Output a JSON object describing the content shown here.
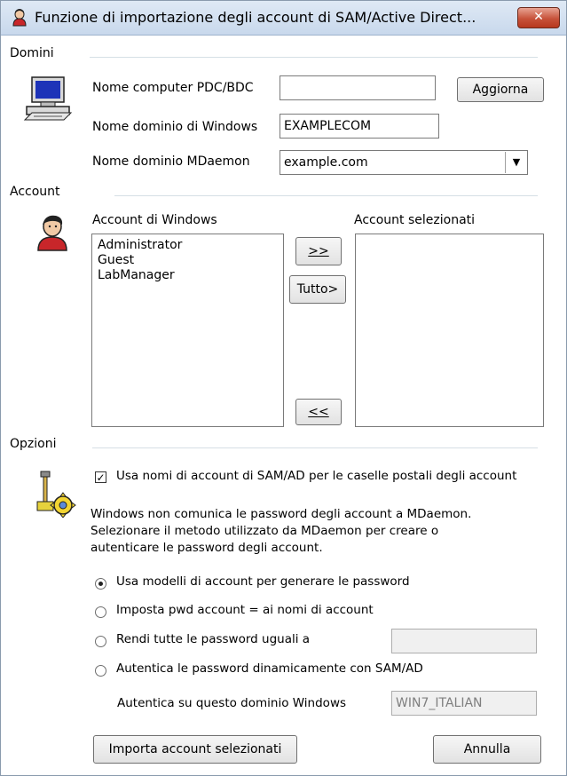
{
  "window": {
    "title": "Funzione di importazione degli account di SAM/Active Direct...",
    "close_label": "✕"
  },
  "domains": {
    "group_label": "Domini",
    "pdc_label": "Nome computer PDC/BDC",
    "pdc_value": "",
    "refresh_button": "Aggiorna",
    "windows_domain_label": "Nome dominio di Windows",
    "windows_domain_value": "EXAMPLECOM",
    "mdaemon_domain_label": "Nome dominio MDaemon",
    "mdaemon_domain_value": "example.com"
  },
  "accounts": {
    "group_label": "Account",
    "windows_accounts_label": "Account di Windows",
    "windows_accounts": [
      "Administrator",
      "Guest",
      "LabManager"
    ],
    "selected_accounts_label": "Account selezionati",
    "selected_accounts": [],
    "add_button": ">>",
    "add_all_button": "Tutto>",
    "remove_button": "<<"
  },
  "options": {
    "group_label": "Opzioni",
    "use_sam_names_label": "Usa nomi di account di SAM/AD per le caselle postali degli account",
    "use_sam_names_checked": true,
    "info_line1": "Windows non comunica le password degli account a MDaemon.",
    "info_line2": "Selezionare il metodo utilizzato da MDaemon per creare o",
    "info_line3": "autenticare le password degli account.",
    "radio_templates": "Usa modelli di account per generare le password",
    "radio_pwd_equals_name": "Imposta pwd account = ai nomi di account",
    "radio_same_password": "Rendi tutte le password uguali a",
    "same_password_value": "",
    "radio_dynamic_auth": "Autentica le password dinamicamente con SAM/AD",
    "selected_radio": "templates",
    "auth_domain_label": "Autentica su questo dominio Windows",
    "auth_domain_value": "WIN7_ITALIAN"
  },
  "footer": {
    "import_button": "Importa account selezionati",
    "cancel_button": "Annulla"
  }
}
